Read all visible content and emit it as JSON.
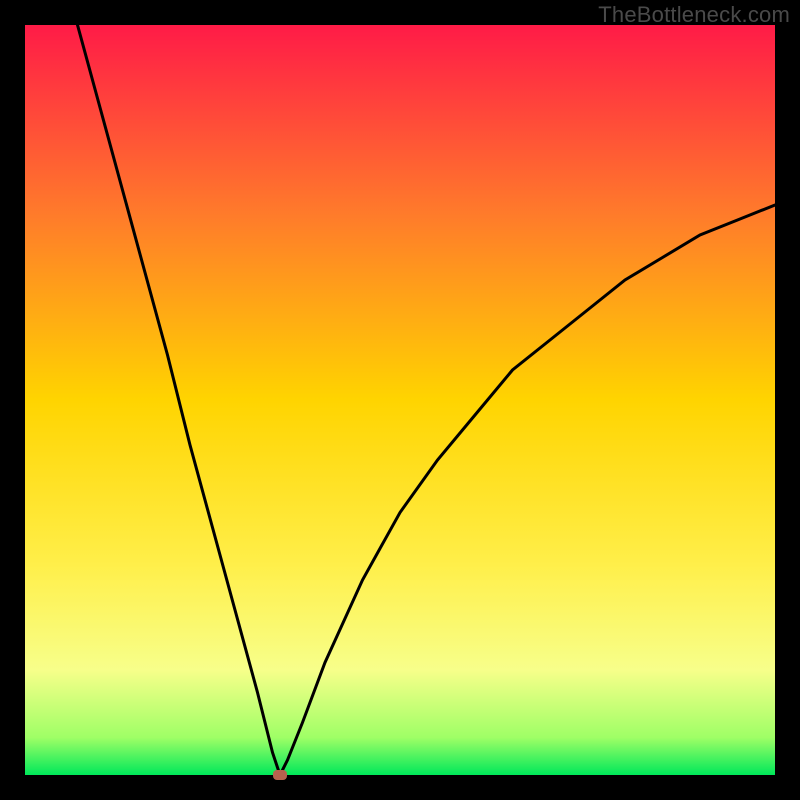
{
  "watermark": {
    "text": "TheBottleneck.com"
  },
  "chart_data": {
    "type": "line",
    "title": "",
    "xlabel": "",
    "ylabel": "",
    "xlim": [
      0,
      100
    ],
    "ylim": [
      0,
      100
    ],
    "grid": false,
    "legend": false,
    "background": {
      "description": "vertical rainbow gradient red→yellow→green mapping bottleneck % (top=100% red, bottom=0% green)",
      "stops": [
        {
          "pct": 0,
          "color": "#ff1b47"
        },
        {
          "pct": 25,
          "color": "#ff7a2b"
        },
        {
          "pct": 50,
          "color": "#ffd400"
        },
        {
          "pct": 72,
          "color": "#ffef4a"
        },
        {
          "pct": 86,
          "color": "#f7ff8a"
        },
        {
          "pct": 95,
          "color": "#9fff66"
        },
        {
          "pct": 100,
          "color": "#00e85a"
        }
      ]
    },
    "series": [
      {
        "name": "bottleneck-curve",
        "description": "V-shaped bottleneck percentage curve; minimum near x≈34",
        "x": [
          7,
          10,
          13,
          16,
          19,
          22,
          25,
          28,
          31,
          33,
          34,
          35,
          37,
          40,
          45,
          50,
          55,
          60,
          65,
          70,
          75,
          80,
          85,
          90,
          95,
          100
        ],
        "y": [
          100,
          89,
          78,
          67,
          56,
          44,
          33,
          22,
          11,
          3,
          0,
          2,
          7,
          15,
          26,
          35,
          42,
          48,
          54,
          58,
          62,
          66,
          69,
          72,
          74,
          76
        ]
      }
    ],
    "marker": {
      "name": "optimal-point",
      "x": 34,
      "y": 0,
      "color": "#b6614e"
    }
  }
}
